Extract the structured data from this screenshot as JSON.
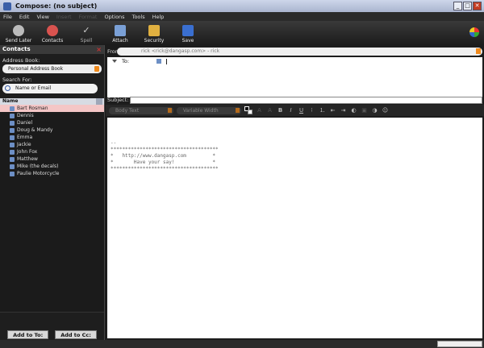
{
  "window": {
    "title": "Compose: (no subject)"
  },
  "menu": [
    {
      "label": "File",
      "enabled": true
    },
    {
      "label": "Edit",
      "enabled": true
    },
    {
      "label": "View",
      "enabled": true
    },
    {
      "label": "Insert",
      "enabled": false
    },
    {
      "label": "Format",
      "enabled": false
    },
    {
      "label": "Options",
      "enabled": true
    },
    {
      "label": "Tools",
      "enabled": true
    },
    {
      "label": "Help",
      "enabled": true
    }
  ],
  "toolbar": {
    "send_later": "Send Later",
    "contacts": "Contacts",
    "spell": "Spell",
    "attach": "Attach",
    "security": "Security",
    "save": "Save"
  },
  "contacts": {
    "title": "Contacts",
    "address_book_label": "Address Book:",
    "address_book_value": "Personal Address Book",
    "search_label": "Search For:",
    "search_placeholder": "Name or Email",
    "column_name": "Name",
    "items": [
      "Bart Rosman",
      "Dennis",
      "Daniel",
      "Doug & Mandy",
      "Emma",
      "Jackie",
      "John Fox",
      "Matthew",
      "Mike (the decals)",
      "Paulie Motorcycle"
    ],
    "add_to_label": "Add to To:",
    "add_to_cc_label": "Add to Cc:"
  },
  "compose": {
    "from_label": "From:",
    "from_value": "rick <rick@dangasp.com>  - rick",
    "to_label": "To:",
    "subject_label": "Subject:",
    "subject_value": "",
    "format": {
      "paragraph": "Body Text",
      "font": "Variable Width"
    },
    "body_text": "--\n*************************************\n*   http://www.dangasp.com         *\n*       Have your say!             *\n*************************************"
  },
  "colors": {
    "accent": "#f08a1c",
    "selection": "#f4c6c6",
    "toolbar_bg": "#1c1c1c"
  }
}
